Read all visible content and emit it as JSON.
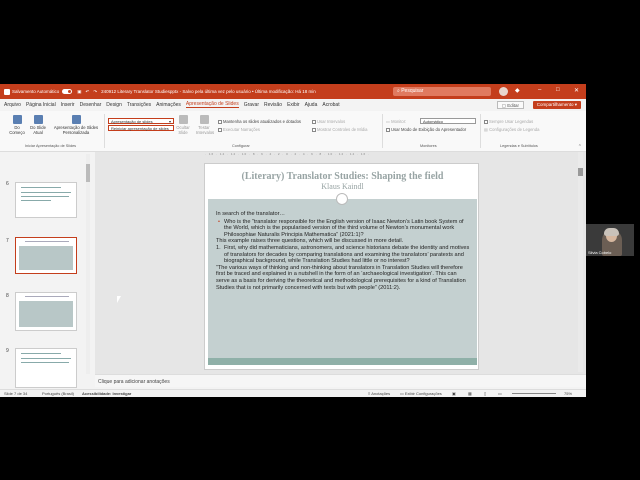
{
  "titlebar": {
    "autosave": "Salvamento Automático",
    "doc_title": "240912 Literary Translator Studiespptx - Salvo pela última vez pelo usuário • Última modificação: Há 18 min",
    "search_placeholder": "Pesquisar",
    "minimize": "–",
    "maximize": "□",
    "close": "✕"
  },
  "menu": {
    "items": [
      "Arquivo",
      "Página Inicial",
      "Inserir",
      "Desenhar",
      "Design",
      "Transições",
      "Animações",
      "Apresentação de Slides",
      "Gravar",
      "Revisão",
      "Exibir",
      "Ajuda",
      "Acrobat"
    ],
    "active": "Apresentação de Slides",
    "comment_label": "Editar",
    "share_label": "Compartilhamento"
  },
  "ribbon": {
    "btn_from_start": "Do Começo",
    "btn_from_current": "Do Slide Atual",
    "btn_custom": "Apresentação de Slides Personalizada",
    "group_start": "Iniciar Apresentação de Slides",
    "dropdown_a": "Apresentação de slides",
    "dropdown_b": "Reiniciar apresentação de slides",
    "btn_hide": "Ocultar Slide",
    "btn_rehearse": "Testar Intervalos",
    "btn_record": "Gravar",
    "chk_keep_updated": "Mantenha os slides atualizados e dotados",
    "chk_narration": "Executar Narrações",
    "chk_timings": "Usar Intervalos",
    "chk_media": "Mostrar Controles de Mídia",
    "group_config": "Configurar",
    "monitor_label": "Monitor:",
    "monitor_value": "Automático",
    "chk_presenter": "Usar Modo de Exibição do Apresentador",
    "group_monitors": "Monitores",
    "chk_subtitles": "Sempre Usar Legendas",
    "subtitle_settings": "Configurações de Legenda",
    "group_captions": "Legendas e Subtítulos"
  },
  "thumbnails": {
    "numbers": [
      "6",
      "7",
      "8",
      "9"
    ],
    "selected": "7"
  },
  "slide": {
    "title": "(Literary) Translator Studies: Shaping the field",
    "author": "Klaus Kaindl",
    "intro": "In search of the translator…",
    "bullet_marker": "•",
    "bullet1": "Who is the “translator responsible for the English version of Isaac Newton’s Latin book System of the World, which is the popularised version of the third volume of Newton’s monumental work Philosophiae Naturalis Principia Mathematica” (2021:1)?",
    "para2": "This example raises three questions, which will be discussed in more detail.",
    "num_marker": "1.",
    "numbered1": "First, why did mathematicians, astronomers, and science historians debate the identity and motives of translators for decades by comparing translations and examining the translators’ paratexts and biographical background, while Translation Studies had little or no interest?",
    "quote": "“The various ways of thinking and non-thinking about translators in Translation Studies will therefore first be traced and explained in a nutshell in the form of an ‘archaeological investigation’. This can serve as a basis for deriving the theoretical and methodological prerequisites for a kind of Translation Studies that is not primarily concerned with texts but with people” (2011:2)."
  },
  "ruler_text": "· 16 · 14 · 12 · 10 · 8 · 6 · 4 · 2 · 0 · 2 · 4 · 6 · 8 · 10 · 12 · 14 · 16 ·",
  "notes_placeholder": "Clique para adicionar anotações",
  "statusbar": {
    "slide_count": "Slide 7 de 34",
    "language": "Português (Brasil)",
    "accessibility": "Acessibilidade: Investigar",
    "notes": "Anotações",
    "display_settings": "Exibir Configurações",
    "zoom": "75%"
  },
  "webcam": {
    "name": "Silvia Cobelo"
  }
}
